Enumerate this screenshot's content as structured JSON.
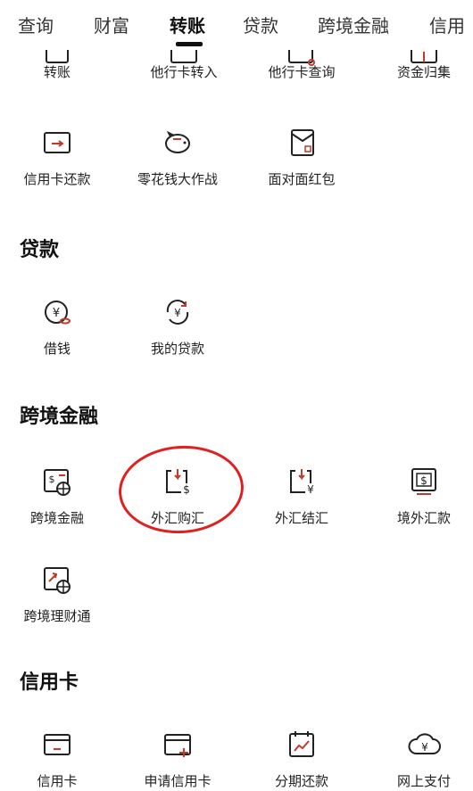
{
  "tabs": [
    "查询",
    "财富",
    "转账",
    "贷款",
    "跨境金融",
    "信用"
  ],
  "transfer_items": [
    "转账",
    "他行卡转入",
    "他行卡查询",
    "资金归集",
    "信用卡还款",
    "零花钱大作战",
    "面对面红包"
  ],
  "loan": {
    "title": "贷款",
    "items": [
      "借钱",
      "我的贷款"
    ]
  },
  "cross": {
    "title": "跨境金融",
    "items": [
      "跨境金融",
      "外汇购汇",
      "外汇结汇",
      "境外汇款",
      "跨境理财通"
    ]
  },
  "credit": {
    "title": "信用卡",
    "items": [
      "信用卡",
      "申请信用卡",
      "分期还款",
      "网上支付"
    ]
  },
  "colors": {
    "accent": "#e02020",
    "icon_red": "#c0392b",
    "text": "#222222"
  }
}
